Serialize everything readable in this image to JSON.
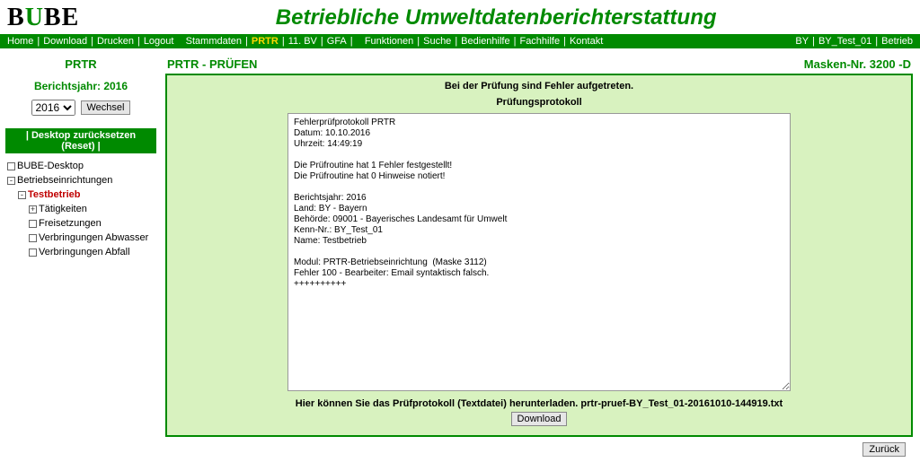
{
  "logo_parts": {
    "b1": "B",
    "u": "U",
    "b2": "B",
    "e": "E"
  },
  "app_title": "Betriebliche Umweltdatenberichterstattung",
  "nav_left": [
    "Home",
    "Download",
    "Drucken",
    "Logout"
  ],
  "nav_mid": [
    "Stammdaten",
    "PRTR",
    "11. BV",
    "GFA"
  ],
  "nav_mid2": [
    "Funktionen",
    "Suche",
    "Bedienhilfe",
    "Fachhilfe",
    "Kontakt"
  ],
  "nav_right": [
    "BY",
    "BY_Test_01",
    "Betrieb"
  ],
  "sidebar": {
    "title": "PRTR",
    "year_label": "Berichtsjahr: 2016",
    "year_value": "2016",
    "wechsel": "Wechsel",
    "reset": "| Desktop zurücksetzen (Reset) |",
    "tree": [
      {
        "label": "BUBE-Desktop",
        "indent": 0,
        "icon": "box"
      },
      {
        "label": "Betriebseinrichtungen",
        "indent": 0,
        "icon": "minus"
      },
      {
        "label": "Testbetrieb",
        "indent": 1,
        "icon": "minus",
        "current": true
      },
      {
        "label": "Tätigkeiten",
        "indent": 2,
        "icon": "plus"
      },
      {
        "label": "Freisetzungen",
        "indent": 2,
        "icon": "box"
      },
      {
        "label": "Verbringungen Abwasser",
        "indent": 2,
        "icon": "box"
      },
      {
        "label": "Verbringungen Abfall",
        "indent": 2,
        "icon": "box"
      }
    ]
  },
  "main": {
    "title": "PRTR - PRÜFEN",
    "mask": "Masken-Nr. 3200 -D",
    "error_heading": "Bei der Prüfung sind Fehler aufgetreten.",
    "protocol_heading": "Prüfungsprotokoll",
    "protocol_text": "Fehlerprüfprotokoll PRTR\nDatum: 10.10.2016\nUhrzeit: 14:49:19\n\nDie Prüfroutine hat 1 Fehler festgestellt!\nDie Prüfroutine hat 0 Hinweise notiert!\n\nBerichtsjahr: 2016\nLand: BY - Bayern\nBehörde: 09001 - Bayerisches Landesamt für Umwelt\nKenn-Nr.: BY_Test_01\nName: Testbetrieb\n\nModul: PRTR-Betriebseinrichtung  (Maske 3112)\nFehler 100 - Bearbeiter: Email syntaktisch falsch.\n++++++++++",
    "download_hint_prefix": "Hier können Sie das Prüfprotokoll (Textdatei) herunterladen. ",
    "download_file": "prtr-pruef-BY_Test_01-20161010-144919.txt",
    "download_btn": "Download",
    "back_btn": "Zurück"
  }
}
